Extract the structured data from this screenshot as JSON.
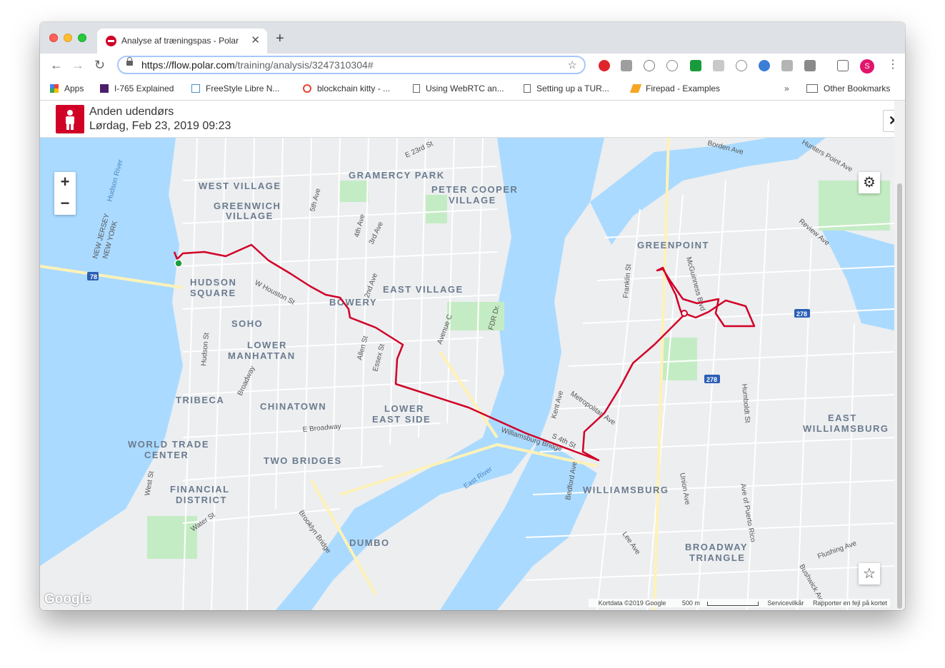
{
  "browser": {
    "tab_title": "Analyse af træningspas - Polar",
    "url_host": "https://flow.polar.com",
    "url_path": "/training/analysis/3247310304#",
    "avatar_letter": "S"
  },
  "bookmarks": [
    {
      "label": "Apps"
    },
    {
      "label": "I-765 Explained"
    },
    {
      "label": "FreeStyle Libre N..."
    },
    {
      "label": "blockchain kitty - ..."
    },
    {
      "label": "Using WebRTC an..."
    },
    {
      "label": "Setting up a TUR..."
    },
    {
      "label": "Firepad - Examples"
    },
    {
      "label": "Other Bookmarks"
    }
  ],
  "session": {
    "title": "Anden udendørs",
    "datetime": "Lørdag, Feb 23, 2019 09:23"
  },
  "map": {
    "route_color": "#d10027",
    "neighborhoods": [
      "WEST VILLAGE",
      "GREENWICH",
      "VILLAGE",
      "GRAMERCY PARK",
      "PETER COOPER",
      "VILLAGE",
      "HUDSON",
      "SQUARE",
      "SOHO",
      "LOWER",
      "MANHATTAN",
      "EAST VILLAGE",
      "BOWERY",
      "TRIBECA",
      "CHINATOWN",
      "LOWER",
      "EAST SIDE",
      "WORLD TRADE",
      "CENTER",
      "TWO BRIDGES",
      "FINANCIAL",
      "DISTRICT",
      "DUMBO",
      "GREENPOINT",
      "WILLIAMSBURG",
      "EAST",
      "WILLIAMSBURG",
      "BROADWAY",
      "TRIANGLE"
    ],
    "streets": [
      "E 23rd St",
      "W Houston St",
      "5th Ave",
      "4th Ave",
      "3rd Ave",
      "2nd Ave",
      "Avenue C",
      "FDR Dr.",
      "Allen St",
      "Essex St",
      "Hudson St",
      "Broadway",
      "E Broadway",
      "West St",
      "Water St",
      "Brooklyn Bridge",
      "Williamsburg Bridge",
      "Kent Ave",
      "Metropolitan Ave",
      "S 4th St",
      "Bedford Ave",
      "Franklin St",
      "McGuinness Blvd",
      "Humboldt St",
      "Union Ave",
      "Lee Ave",
      "Ave of Puerto Rico",
      "Flushing Ave",
      "Bushwick Ave",
      "Review Ave",
      "Borden Ave",
      "Hunters Point Ave",
      "East River",
      "Hudson River",
      "NEW JERSEY",
      "NEW YORK"
    ],
    "highway_shields": [
      "78",
      "278",
      "278"
    ],
    "attribution": "Kortdata ©2019 Google",
    "scale": "500 m",
    "terms": "Servicevilkår",
    "report": "Rapporter en fejl på kortet",
    "google": "Google"
  }
}
